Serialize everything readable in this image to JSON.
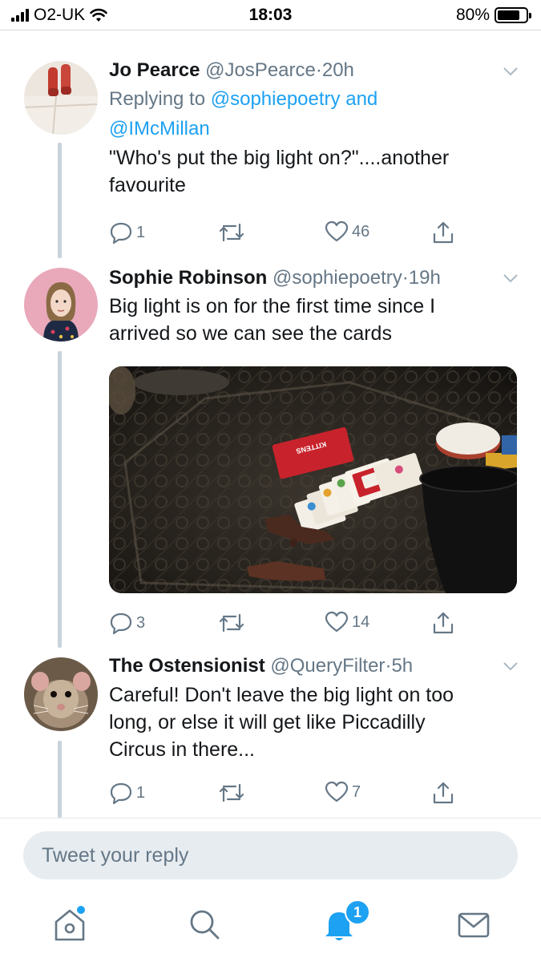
{
  "status_bar": {
    "carrier": "O2-UK",
    "time": "18:03",
    "battery_percent": "80%",
    "battery_level": 0.8
  },
  "tweets": [
    {
      "name": "Jo Pearce",
      "handle": "@JosPearce",
      "separator": "·",
      "age": "20h",
      "reply_prefix": "Replying to",
      "reply_user_1": "@sophiepoetry",
      "reply_joiner": "and",
      "reply_user_2": "@IMcMillan",
      "text_line_1": "\"Who's put the big light on?\"....another",
      "text_line_2": "favourite",
      "reply_count": "1",
      "retweet_count": "",
      "like_count": "46"
    },
    {
      "name": "Sophie Robinson",
      "handle": "@sophiepoetry",
      "separator": "·",
      "age": "19h",
      "text_line_1": "Big light is on for the first time since I",
      "text_line_2": "arrived so we can see the cards",
      "reply_count": "3",
      "retweet_count": "",
      "like_count": "14",
      "image_card_text": "KITTENS"
    },
    {
      "name": "The Ostensionist",
      "handle": "@QueryFilter",
      "separator": "·",
      "age": "5h",
      "text_line_1": "Careful! Don't leave the big light on too",
      "text_line_2": "long, or else it will get like Piccadilly",
      "text_line_3": "Circus in there...",
      "reply_count": "1",
      "retweet_count": "",
      "like_count": "7"
    }
  ],
  "reply_box": {
    "placeholder": "Tweet your reply"
  },
  "tab_bar": {
    "tabs": [
      "home",
      "search",
      "notifications",
      "messages"
    ],
    "notifications_badge": "1"
  },
  "colors": {
    "accent": "#1da1f2",
    "secondary_text": "#657786",
    "thread_line": "#c9d3dc"
  }
}
